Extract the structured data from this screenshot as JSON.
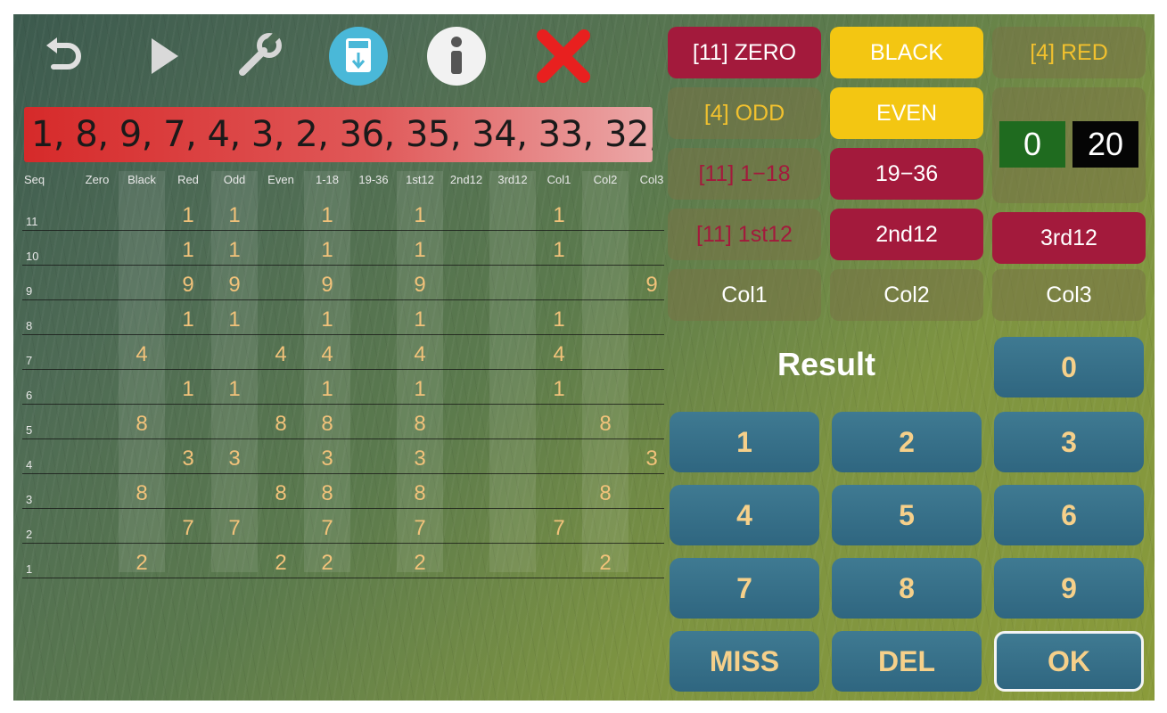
{
  "history": "1, 8, 9, 7, 4, 3, 2, 36, 35, 34, 33, 32,",
  "table": {
    "headers": [
      "Seq",
      "Zero",
      "Black",
      "Red",
      "Odd",
      "Even",
      "1-18",
      "19-36",
      "1st12",
      "2nd12",
      "3rd12",
      "Col1",
      "Col2",
      "Col3"
    ],
    "rows": [
      {
        "seq": "11",
        "cells": [
          "",
          "",
          "1",
          "1",
          "",
          "1",
          "",
          "1",
          "",
          "",
          "1",
          "",
          ""
        ]
      },
      {
        "seq": "10",
        "cells": [
          "",
          "",
          "1",
          "1",
          "",
          "1",
          "",
          "1",
          "",
          "",
          "1",
          "",
          ""
        ]
      },
      {
        "seq": "9",
        "cells": [
          "",
          "",
          "9",
          "9",
          "",
          "9",
          "",
          "9",
          "",
          "",
          "",
          "",
          "9"
        ]
      },
      {
        "seq": "8",
        "cells": [
          "",
          "",
          "1",
          "1",
          "",
          "1",
          "",
          "1",
          "",
          "",
          "1",
          "",
          ""
        ]
      },
      {
        "seq": "7",
        "cells": [
          "",
          "4",
          "",
          "",
          "4",
          "4",
          "",
          "4",
          "",
          "",
          "4",
          "",
          ""
        ]
      },
      {
        "seq": "6",
        "cells": [
          "",
          "",
          "1",
          "1",
          "",
          "1",
          "",
          "1",
          "",
          "",
          "1",
          "",
          ""
        ]
      },
      {
        "seq": "5",
        "cells": [
          "",
          "8",
          "",
          "",
          "8",
          "8",
          "",
          "8",
          "",
          "",
          "",
          "8",
          ""
        ]
      },
      {
        "seq": "4",
        "cells": [
          "",
          "",
          "3",
          "3",
          "",
          "3",
          "",
          "3",
          "",
          "",
          "",
          "",
          "3"
        ]
      },
      {
        "seq": "3",
        "cells": [
          "",
          "8",
          "",
          "",
          "8",
          "8",
          "",
          "8",
          "",
          "",
          "",
          "8",
          ""
        ]
      },
      {
        "seq": "2",
        "cells": [
          "",
          "",
          "7",
          "7",
          "",
          "7",
          "",
          "7",
          "",
          "",
          "7",
          "",
          ""
        ]
      },
      {
        "seq": "1",
        "cells": [
          "",
          "2",
          "",
          "",
          "2",
          "2",
          "",
          "2",
          "",
          "",
          "",
          "2",
          ""
        ]
      }
    ]
  },
  "bets": {
    "zero": "[11] ZERO",
    "black": "BLACK",
    "red": "[4] RED",
    "odd": "[4] ODD",
    "even": "EVEN",
    "low": "[11] 1−18",
    "high": "19−36",
    "first12": "[11] 1st12",
    "second12": "2nd12",
    "third12": "3rd12",
    "col1": "Col1",
    "col2": "Col2",
    "col3": "Col3"
  },
  "counter": {
    "hits": "0",
    "total": "20"
  },
  "keypad": {
    "result_label": "Result",
    "k0": "0",
    "k1": "1",
    "k2": "2",
    "k3": "3",
    "k4": "4",
    "k5": "5",
    "k6": "6",
    "k7": "7",
    "k8": "8",
    "k9": "9",
    "miss": "MISS",
    "del": "DEL",
    "ok": "OK"
  },
  "colors": {
    "bet_red": "#a31a3c",
    "bet_yellow": "#f3c612",
    "keypad_blue": "#356d86",
    "history_red": "#d62a2a"
  },
  "icons": {
    "back": "undo-icon",
    "play": "play-icon",
    "settings": "wrench-icon",
    "export": "csv-export-icon",
    "info": "info-icon",
    "close": "close-icon"
  }
}
